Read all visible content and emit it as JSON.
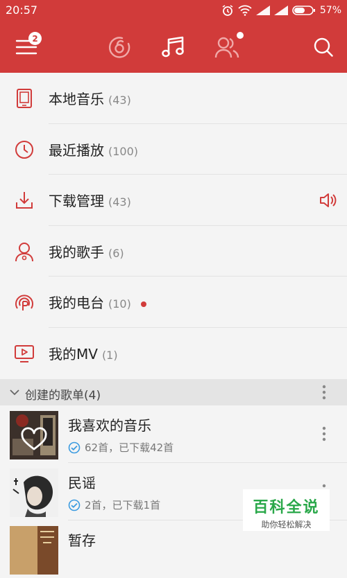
{
  "status_bar": {
    "time": "20:57",
    "battery": "57%",
    "icons": [
      "alarm-icon",
      "wifi-icon",
      "signal-icon",
      "signal-icon",
      "battery-icon"
    ]
  },
  "app_bar": {
    "menu_badge": "2",
    "tabs": [
      "music-disc-icon",
      "music-note-icon",
      "friends-icon"
    ],
    "active_tab": "music-note-icon",
    "search_icon": "search-icon"
  },
  "menu": {
    "items": [
      {
        "label": "本地音乐",
        "count": "(43)",
        "icon": "phone-icon"
      },
      {
        "label": "最近播放",
        "count": "(100)",
        "icon": "clock-icon"
      },
      {
        "label": "下载管理",
        "count": "(43)",
        "icon": "download-icon",
        "extra": "speaker-icon"
      },
      {
        "label": "我的歌手",
        "count": "(6)",
        "icon": "singer-icon"
      },
      {
        "label": "我的电台",
        "count": "(10)",
        "icon": "radio-icon",
        "extra": "red-dot"
      },
      {
        "label": "我的MV",
        "count": "(1)",
        "icon": "video-icon"
      }
    ]
  },
  "playlists_section": {
    "title": "创建的歌单(4)"
  },
  "playlists": [
    {
      "name": "我喜欢的音乐",
      "meta": "62首，已下载42首"
    },
    {
      "name": "民谣",
      "meta": "2首，已下载1首"
    },
    {
      "name": "暂存",
      "meta": ""
    }
  ],
  "watermark": {
    "title": "百科全说",
    "subtitle": "助你轻松解决"
  },
  "colors": {
    "accent": "#d13b3a",
    "background": "#f4f4f4",
    "check": "#3b9be0",
    "watermark": "#2aa84a"
  }
}
